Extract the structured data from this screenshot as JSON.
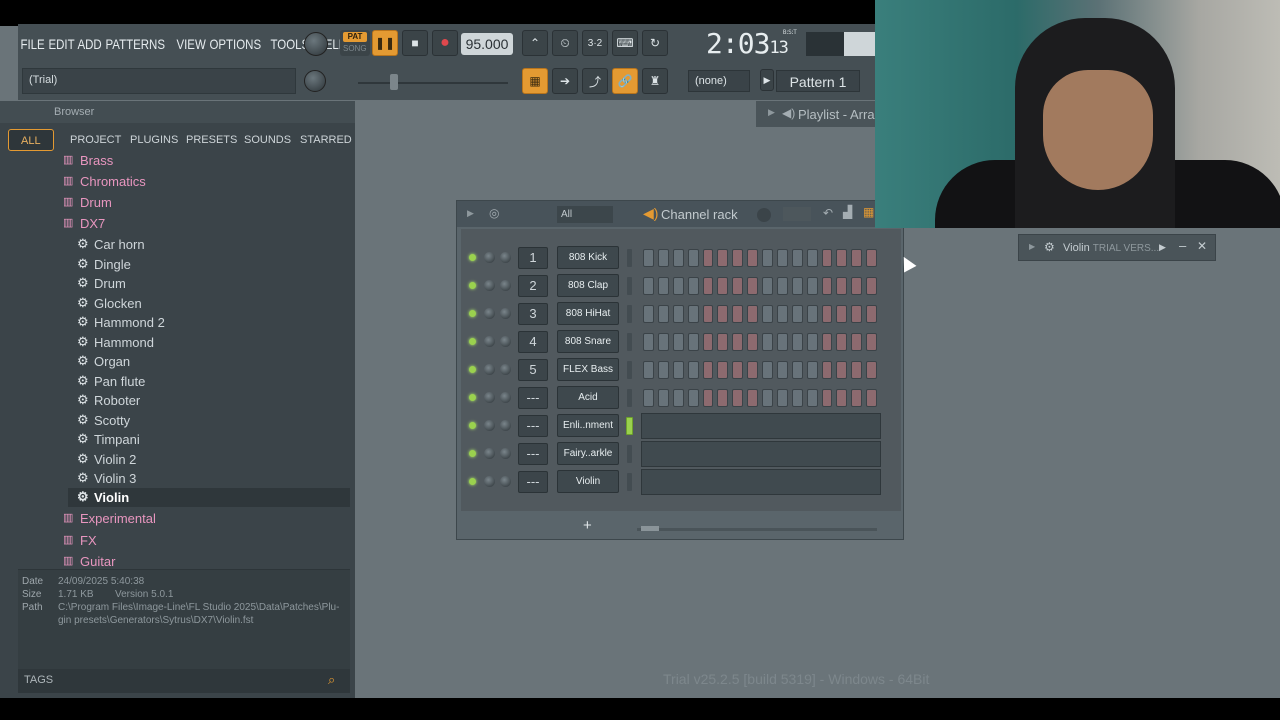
{
  "menu": [
    "FILE",
    "EDIT",
    "ADD",
    "PATTERNS",
    "VIEW",
    "OPTIONS",
    "TOOLS",
    "HELP"
  ],
  "hint": "(Trial)",
  "transport": {
    "pat": "PAT",
    "song": "SONG",
    "tempo": "95.000",
    "time_main": "2:03",
    "time_sub": "13",
    "time_unit": "B:S:T"
  },
  "pattern_selector": {
    "none": "(none)",
    "pattern": "Pattern 1"
  },
  "browser": {
    "title": "Browser",
    "tabs": [
      "ALL",
      "PROJECT",
      "PLUGINS",
      "PRESETS",
      "SOUNDS",
      "STARRED"
    ],
    "tree": [
      {
        "label": "Brass",
        "type": "folder"
      },
      {
        "label": "Chromatics",
        "type": "folder"
      },
      {
        "label": "Drum",
        "type": "folder"
      },
      {
        "label": "DX7",
        "type": "folder"
      },
      {
        "label": "Car horn",
        "type": "patch"
      },
      {
        "label": "Dingle",
        "type": "patch"
      },
      {
        "label": "Drum",
        "type": "patch"
      },
      {
        "label": "Glocken",
        "type": "patch"
      },
      {
        "label": "Hammond 2",
        "type": "patch"
      },
      {
        "label": "Hammond",
        "type": "patch"
      },
      {
        "label": "Organ",
        "type": "patch"
      },
      {
        "label": "Pan flute",
        "type": "patch"
      },
      {
        "label": "Roboter",
        "type": "patch"
      },
      {
        "label": "Scotty",
        "type": "patch"
      },
      {
        "label": "Timpani",
        "type": "patch"
      },
      {
        "label": "Violin 2",
        "type": "patch"
      },
      {
        "label": "Violin 3",
        "type": "patch"
      },
      {
        "label": "Violin",
        "type": "patch",
        "selected": true
      },
      {
        "label": "Experimental",
        "type": "folder"
      },
      {
        "label": "FX",
        "type": "folder"
      },
      {
        "label": "Guitar",
        "type": "folder"
      }
    ],
    "info": {
      "date_label": "Date",
      "date": "24/09/2025 5:40:38",
      "size_label": "Size",
      "size": "1.71 KB",
      "version": "Version 5.0.1",
      "path_label": "Path",
      "path_1": "C:\\Program Files\\Image-Line\\FL Studio 2025\\Data\\Patches\\Plu-",
      "path_2": "gin presets\\Generators\\Sytrus\\DX7\\Violin.fst"
    },
    "tags": "TAGS"
  },
  "playlist_tab": "Playlist - Arra",
  "violin_window": {
    "name": "Violin",
    "trial": "TRIAL VERS..."
  },
  "channel_rack": {
    "title": "Channel rack",
    "filter": "All",
    "channels": [
      {
        "num": "1",
        "name": "808 Kick",
        "kind": "steps"
      },
      {
        "num": "2",
        "name": "808 Clap",
        "kind": "steps"
      },
      {
        "num": "3",
        "name": "808 HiHat",
        "kind": "steps"
      },
      {
        "num": "4",
        "name": "808 Snare",
        "kind": "steps"
      },
      {
        "num": "5",
        "name": "FLEX Bass",
        "kind": "steps"
      },
      {
        "num": "---",
        "name": "Acid",
        "kind": "steps"
      },
      {
        "num": "---",
        "name": "Enli..nment",
        "kind": "roll",
        "selected": true
      },
      {
        "num": "---",
        "name": "Fairy..arkle",
        "kind": "roll"
      },
      {
        "num": "---",
        "name": "Violin",
        "kind": "roll"
      }
    ],
    "add": "+"
  },
  "footer_version": "Trial v25.2.5 [build 5319] - Windows - 64Bit"
}
